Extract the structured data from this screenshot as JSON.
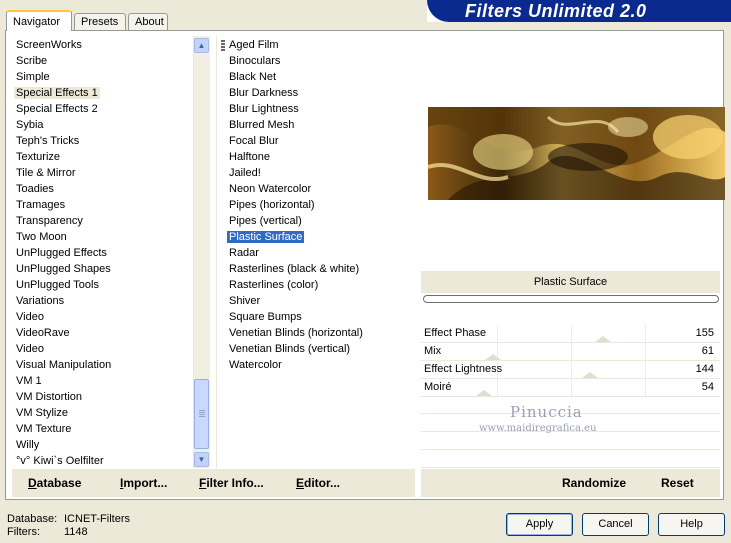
{
  "tabs": [
    {
      "label": "Navigator",
      "active": true
    },
    {
      "label": "Presets",
      "active": false
    },
    {
      "label": "About",
      "active": false
    }
  ],
  "banner_title": "Filters Unlimited 2.0",
  "categories": {
    "items": [
      "ScreenWorks",
      "Scribe",
      "Simple",
      "Special Effects 1",
      "Special Effects 2",
      "Sybia",
      "Teph's Tricks",
      "Texturize",
      "Tile & Mirror",
      "Toadies",
      "Tramages",
      "Transparency",
      "Two Moon",
      "UnPlugged Effects",
      "UnPlugged Shapes",
      "UnPlugged Tools",
      "Variations",
      "Video",
      "VideoRave",
      "Video",
      "Visual Manipulation",
      "VM 1",
      "VM Distortion",
      "VM Stylize",
      "VM Texture",
      "Willy",
      "°v° Kiwi`s Oelfilter"
    ],
    "selected": "Special Effects 1",
    "scroll_up_icon": "chevron-up-icon",
    "scroll_down_icon": "chevron-down-icon"
  },
  "filters": {
    "items": [
      "Aged Film",
      "Binoculars",
      "Black Net",
      "Blur Darkness",
      "Blur Lightness",
      "Blurred Mesh",
      "Focal Blur",
      "Halftone",
      "Jailed!",
      "Neon Watercolor",
      "Pipes (horizontal)",
      "Pipes (vertical)",
      "Plastic Surface",
      "Radar",
      "Rasterlines (black & white)",
      "Rasterlines (color)",
      "Shiver",
      "Square Bumps",
      "Venetian Blinds (horizontal)",
      "Venetian Blinds (vertical)",
      "Watercolor"
    ],
    "selected": "Plastic Surface"
  },
  "bottom_buttons": {
    "database": "Database",
    "import": "Import...",
    "filter_info": "Filter Info...",
    "editor": "Editor...",
    "randomize": "Randomize",
    "reset": "Reset"
  },
  "filter_name": "Plastic Surface",
  "parameters": [
    {
      "label": "Effect Phase",
      "value": "155",
      "max": 255
    },
    {
      "label": "Mix",
      "value": "61",
      "max": 255
    },
    {
      "label": "Effect Lightness",
      "value": "144",
      "max": 255
    },
    {
      "label": "Moiré",
      "value": "54",
      "max": 255
    }
  ],
  "watermark": {
    "name": "Pinuccia",
    "url": "www.maidiregrafica.eu"
  },
  "status": {
    "database_label": "Database:",
    "database_value": "ICNET-Filters",
    "filters_label": "Filters:",
    "filters_value": "1148"
  },
  "dialog_buttons": {
    "apply": "Apply",
    "cancel": "Cancel",
    "help": "Help"
  },
  "colors": {
    "selection": "#316ac5",
    "banner": "#0b2a8f",
    "tab_accent": "#ffc83c"
  }
}
